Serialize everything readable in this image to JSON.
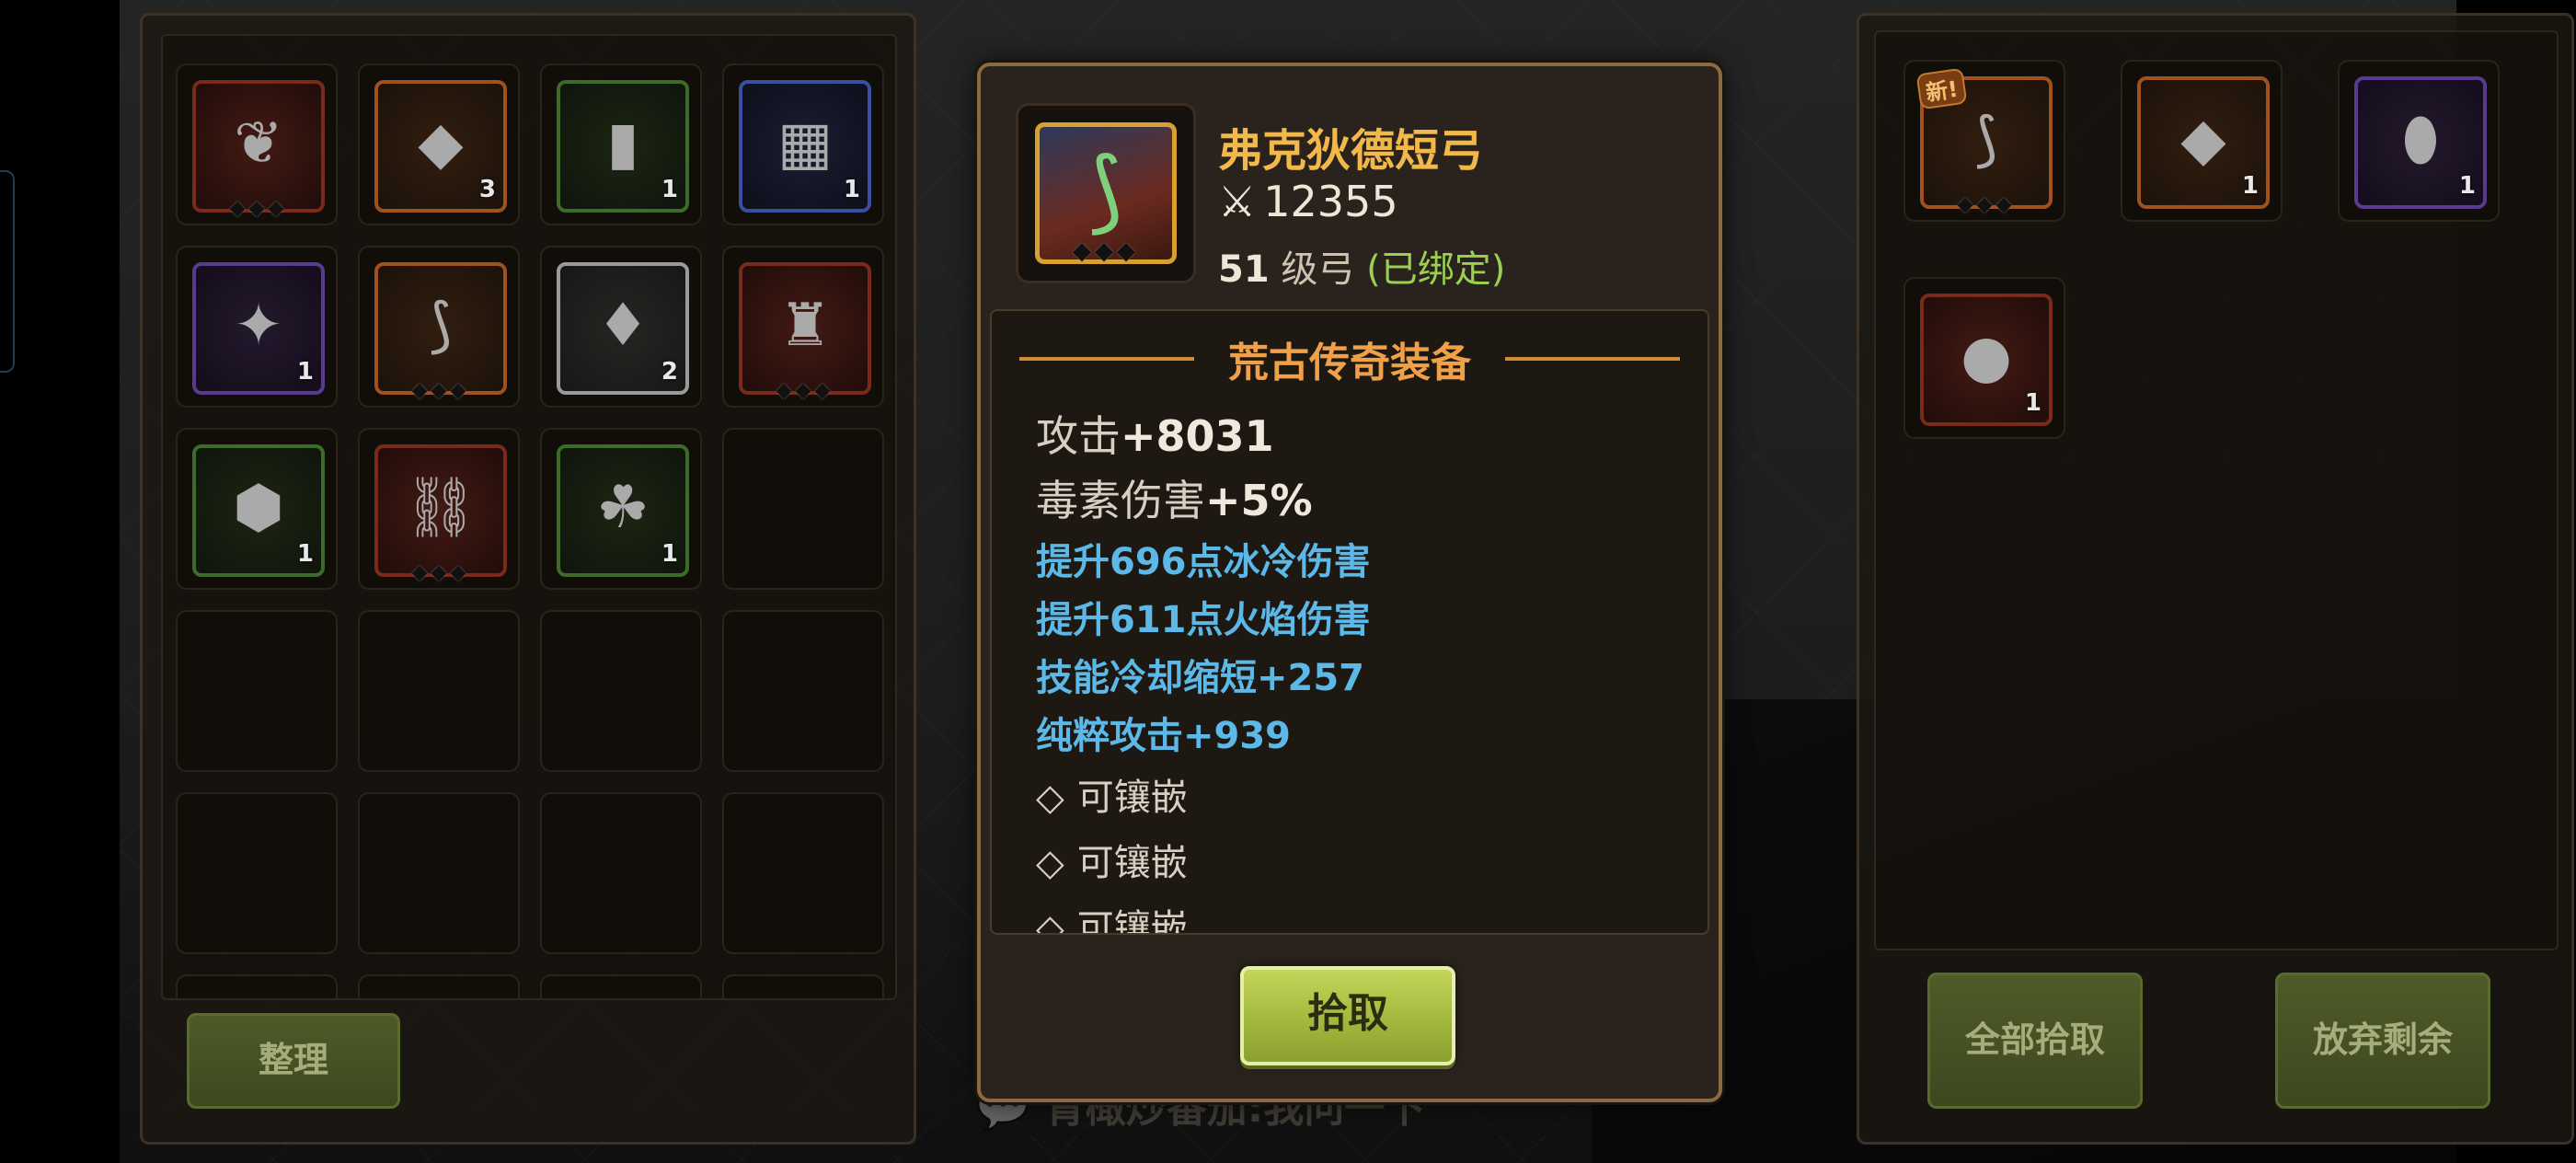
{
  "left_panel": {
    "sort_button": "整理",
    "slots": [
      {
        "icon": "leaf-armor-icon",
        "glyph": "❦",
        "rarity": "red",
        "count": "",
        "gems": "◆◆◆"
      },
      {
        "icon": "crystal-icon",
        "glyph": "◆",
        "rarity": "orange",
        "count": "3",
        "gems": ""
      },
      {
        "icon": "scroll-icon",
        "glyph": "▮",
        "rarity": "green",
        "count": "1",
        "gems": ""
      },
      {
        "icon": "blue-banner-icon",
        "glyph": "▦",
        "rarity": "blue",
        "count": "1",
        "gems": ""
      },
      {
        "icon": "blue-crystal-shard-icon",
        "glyph": "✦",
        "rarity": "purple",
        "count": "1",
        "gems": ""
      },
      {
        "icon": "bow-icon",
        "glyph": "⟆",
        "rarity": "orange",
        "count": "",
        "gems": "◆◆◆"
      },
      {
        "icon": "pink-gem-icon",
        "glyph": "♦",
        "rarity": "white",
        "count": "2",
        "gems": ""
      },
      {
        "icon": "red-robe-icon",
        "glyph": "♜",
        "rarity": "red",
        "count": "",
        "gems": "◆◆◆"
      },
      {
        "icon": "green-stone-icon",
        "glyph": "⬢",
        "rarity": "green",
        "count": "1",
        "gems": ""
      },
      {
        "icon": "chain-ring-icon",
        "glyph": "⛓",
        "rarity": "red",
        "count": "",
        "gems": "◆◆◆"
      },
      {
        "icon": "herb-icon",
        "glyph": "☘",
        "rarity": "green",
        "count": "1",
        "gems": ""
      }
    ]
  },
  "right_panel": {
    "pickup_all_button": "全部拾取",
    "discard_rest_button": "放弃剩余",
    "slots": [
      {
        "icon": "bow-icon",
        "glyph": "⟆",
        "rarity": "orange",
        "count": "",
        "gems": "◆◆◆",
        "badge": "新!"
      },
      {
        "icon": "crystal-icon",
        "glyph": "◆",
        "rarity": "orange",
        "count": "1",
        "gems": "",
        "badge": ""
      },
      {
        "icon": "egg-icon",
        "glyph": "⬮",
        "rarity": "purple",
        "count": "1",
        "gems": "",
        "badge": ""
      },
      {
        "icon": "fire-orb-icon",
        "glyph": "●",
        "rarity": "red",
        "count": "1",
        "gems": "",
        "badge": ""
      }
    ]
  },
  "tooltip": {
    "name": "弗克狄德短弓",
    "power": "12355",
    "level_number": "51",
    "level_text": "级弓",
    "bound_text": "(已绑定)",
    "section_title": "荒古传奇装备",
    "attrs": [
      {
        "label": "攻击",
        "value": "+8031"
      },
      {
        "label": "毒素伤害",
        "value": "+5%"
      }
    ],
    "bonuses": [
      "提升696点冰冷伤害",
      "提升611点火焰伤害",
      "技能冷却缩短+257",
      "纯粹攻击+939"
    ],
    "sockets": [
      "可镶嵌",
      "可镶嵌",
      "可镶嵌"
    ],
    "pickup_button": "拾取"
  },
  "chat_ghost": "青橄炒番茄:我问一下",
  "colors": {
    "legendary_name": "#f2b84a",
    "bonus_blue": "#5cb8e6",
    "bound_green": "#9ad050",
    "button_green": "#a2b83e"
  }
}
